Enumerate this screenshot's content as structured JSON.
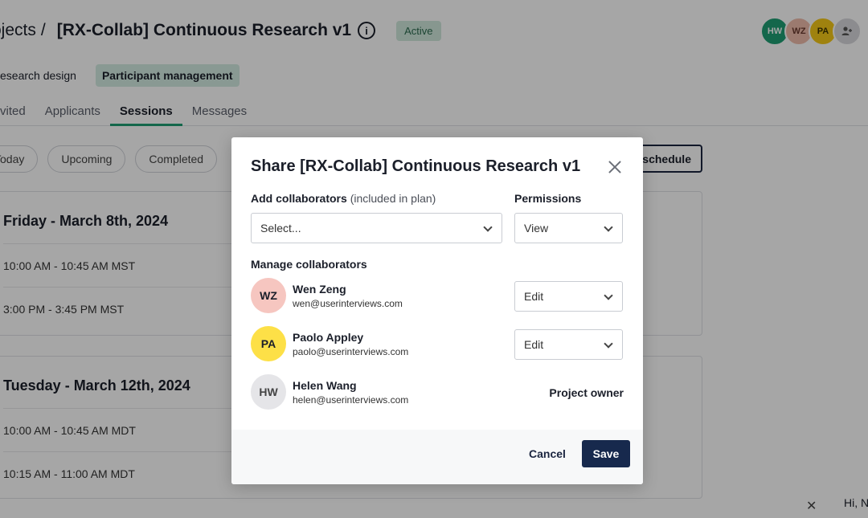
{
  "header": {
    "breadcrumb": "ojects",
    "separator": "/",
    "project_title": "[RX-Collab] Continuous Research v1",
    "info_glyph": "i",
    "status": "Active",
    "avatars": [
      {
        "initials": "HW",
        "color": "#1f9e74"
      },
      {
        "initials": "WZ",
        "color": "#efbcab"
      },
      {
        "initials": "PA",
        "color": "#f5c818"
      },
      {
        "icon": "add-person-icon",
        "glyph": "+"
      }
    ]
  },
  "subnav": {
    "items": [
      "esearch design",
      "Participant management"
    ],
    "active": "Participant management"
  },
  "tabs": {
    "items": [
      "vited",
      "Applicants",
      "Sessions",
      "Messages"
    ],
    "active": "Sessions"
  },
  "filters": {
    "chips": [
      "Today",
      "Upcoming",
      "Completed"
    ],
    "schedule_button": "schedule"
  },
  "days": [
    {
      "title": "Friday - March 8th, 2024",
      "slots": [
        "10:00 AM - 10:45 AM MST",
        "3:00 PM - 3:45 PM MST"
      ]
    },
    {
      "title": "Tuesday - March 12th, 2024",
      "slots": [
        "10:00 AM - 10:45 AM MDT",
        "10:15 AM - 11:00 AM MDT"
      ]
    }
  ],
  "chat": {
    "close_glyph": "✕",
    "greeting": "Hi, N"
  },
  "modal": {
    "title": "Share [RX-Collab] Continuous Research v1",
    "add_label": "Add collaborators",
    "add_label_suffix": "(included in plan)",
    "add_placeholder": "Select...",
    "permissions_label": "Permissions",
    "permissions_value": "View",
    "manage_label": "Manage collaborators",
    "collaborators": [
      {
        "initials": "WZ",
        "name": "Wen Zeng",
        "email": "wen@userinterviews.com",
        "permission": "Edit"
      },
      {
        "initials": "PA",
        "name": "Paolo Appley",
        "email": "paolo@userinterviews.com",
        "permission": "Edit"
      },
      {
        "initials": "HW",
        "name": "Helen Wang",
        "email": "helen@userinterviews.com",
        "role": "Project owner"
      }
    ],
    "cancel_label": "Cancel",
    "save_label": "Save"
  }
}
